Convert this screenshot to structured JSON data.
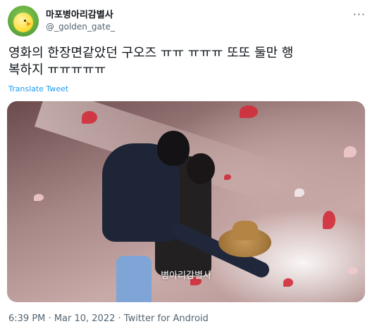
{
  "tweet": {
    "author": {
      "display_name": "마포병아리감별사",
      "handle": "@_golden_gate_"
    },
    "more_icon": "more-horizontal-icon",
    "text_line1": "영화의 한장면같았던 구오즈 ㅠㅠ ㅠㅠㅠ 또또 둘만 행",
    "text_line2": "복하지 ㅠㅠㅠㅠㅠ",
    "translate_label": "Translate Tweet",
    "media": {
      "subtitle": "병아리감별사"
    },
    "time": "6:39 PM",
    "separator": "·",
    "date": "Mar 10, 2022",
    "source": "Twitter for Android"
  },
  "colors": {
    "link": "#1d9bf0",
    "secondary": "#536471",
    "text": "#0f1419"
  }
}
